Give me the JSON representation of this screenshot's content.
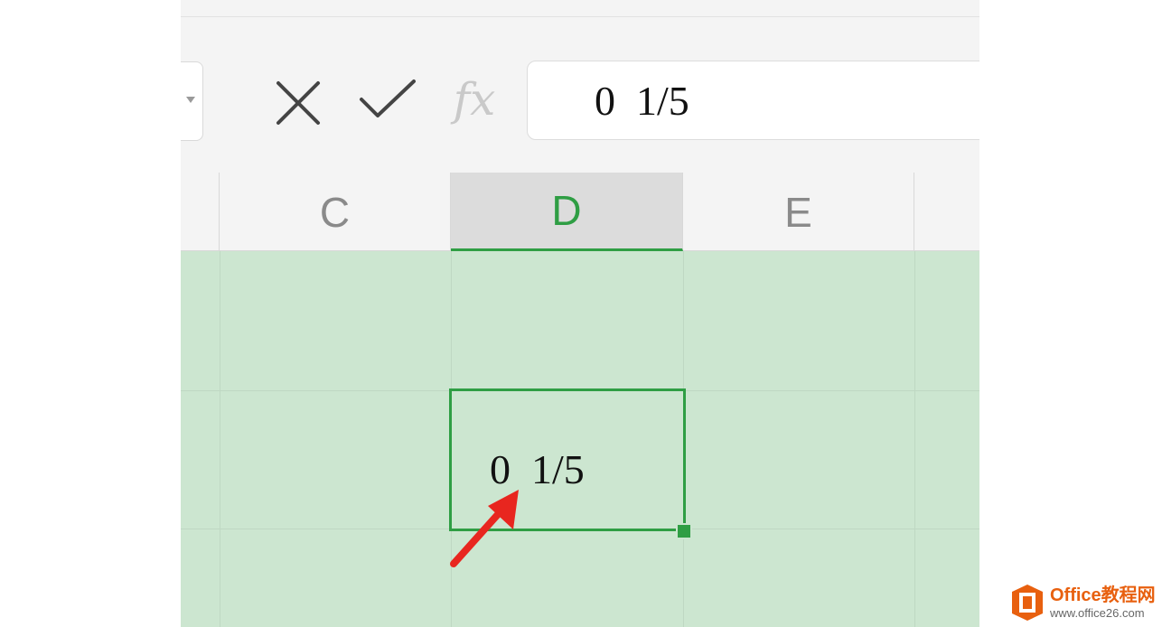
{
  "formula_bar": {
    "value": "0  1/5",
    "fx_label": "fx",
    "cancel_icon": "close-icon",
    "enter_icon": "check-icon"
  },
  "columns": [
    "C",
    "D",
    "E"
  ],
  "selected_column": "D",
  "active_cell": {
    "value": "0  1/5"
  },
  "colors": {
    "accent": "#2f9e44",
    "grid_fill": "#cce6d0",
    "arrow": "#e8261f"
  },
  "watermark": {
    "title": "Office教程网",
    "url": "www.office26.com"
  }
}
